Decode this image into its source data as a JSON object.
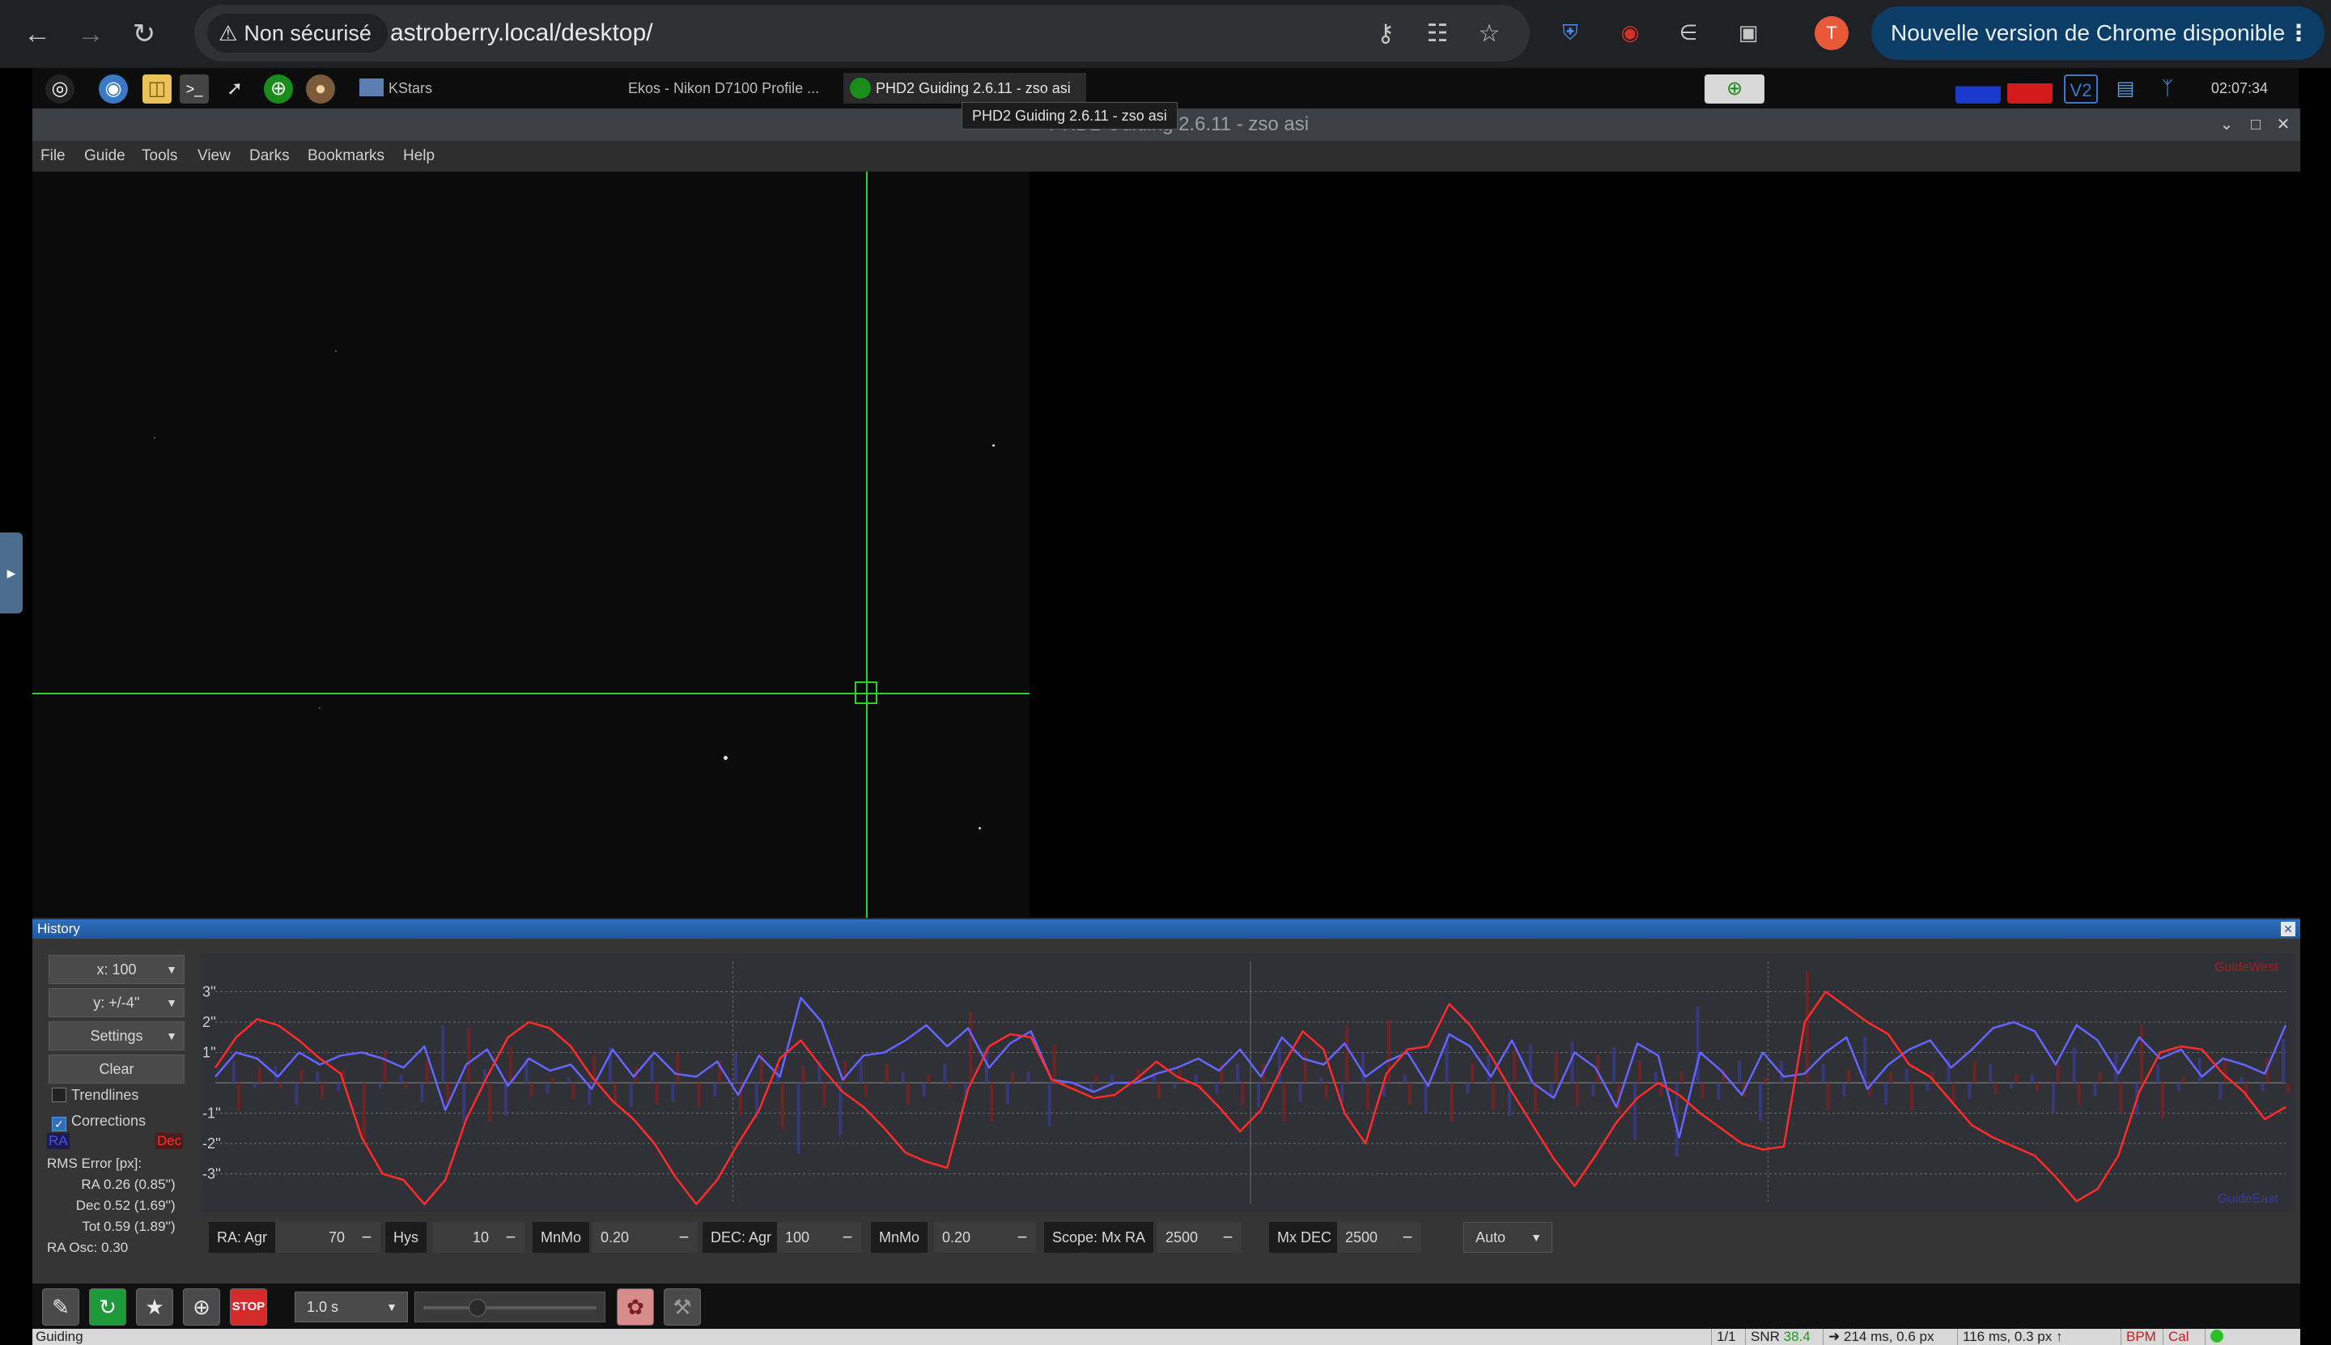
{
  "browser": {
    "security_label": "Non sécurisé",
    "url": "astroberry.local/desktop/",
    "profile_initial": "T",
    "update_label": "Nouvelle version de Chrome disponible",
    "accent": "#0b3d66"
  },
  "taskbar": {
    "tasks": [
      "KStars",
      "Ekos - Nikon D7100 Profile ...",
      "PHD2 Guiding 2.6.11 - zso asi"
    ],
    "clock": "02:07:34",
    "tooltip": "PHD2 Guiding 2.6.11 - zso asi"
  },
  "window": {
    "title": "PHD2 Guiding 2.6.11 - zso asi",
    "menu": [
      "File",
      "Guide",
      "Tools",
      "View",
      "Darks",
      "Bookmarks",
      "Help"
    ]
  },
  "history": {
    "title": "History",
    "x_scale": "x: 100",
    "y_scale": "y: +/-4''",
    "settings_label": "Settings",
    "clear_label": "Clear",
    "trendlines_label": "Trendlines",
    "trendlines_checked": false,
    "corrections_label": "Corrections",
    "corrections_checked": true,
    "ra_label": "RA",
    "dec_label": "Dec",
    "rms_title": "RMS Error [px]:",
    "rms_ra_label": "RA",
    "rms_ra": "0.26 (0.85'')",
    "rms_dec_label": "Dec",
    "rms_dec": "0.52 (1.69'')",
    "rms_tot_label": "Tot",
    "rms_tot": "0.59 (1.89'')",
    "ra_osc": "RA Osc: 0.30",
    "y_ticks": [
      "3''",
      "2''",
      "1''",
      "-1''",
      "-2''",
      "-3''"
    ],
    "legend_top": "GuideWest",
    "legend_bottom": "GuideEast",
    "ra_color": "#6464ff",
    "dec_color": "#ff2a2a",
    "controls": {
      "ra_agr_label": "RA: Agr",
      "ra_agr": "70",
      "hys_label": "Hys",
      "hys": "10",
      "mnmo_label": "MnMo",
      "mnmo": "0.20",
      "dec_agr_label": "DEC: Agr",
      "dec_agr": "100",
      "dec_mnmo_label": "MnMo",
      "dec_mnmo": "0.20",
      "scope_label": "Scope: Mx RA",
      "mx_ra": "2500",
      "mx_dec_label": "Mx DEC",
      "mx_dec": "2500",
      "dec_mode": "Auto"
    }
  },
  "toolbar": {
    "exposure": "1.0 s"
  },
  "status": {
    "state": "Guiding",
    "frame": "1/1",
    "snr_label": "SNR",
    "snr": "38.4",
    "ra_pulse": "214 ms, 0.6 px",
    "dec_pulse": "116 ms, 0.3 px",
    "bpm": "BPM",
    "cal": "Cal"
  },
  "chart_data": {
    "type": "line",
    "ylim": [
      -4,
      4
    ],
    "x": [
      0,
      1,
      2,
      3,
      4,
      5,
      6,
      7,
      8,
      9,
      10,
      11,
      12,
      13,
      14,
      15,
      16,
      17,
      18,
      19,
      20,
      21,
      22,
      23,
      24,
      25,
      26,
      27,
      28,
      29,
      30,
      31,
      32,
      33,
      34,
      35,
      36,
      37,
      38,
      39,
      40,
      41,
      42,
      43,
      44,
      45,
      46,
      47,
      48,
      49,
      50,
      51,
      52,
      53,
      54,
      55,
      56,
      57,
      58,
      59,
      60,
      61,
      62,
      63,
      64,
      65,
      66,
      67,
      68,
      69,
      70,
      71,
      72,
      73,
      74,
      75,
      76,
      77,
      78,
      79,
      80,
      81,
      82,
      83,
      84,
      85,
      86,
      87,
      88,
      89,
      90,
      91,
      92,
      93,
      94,
      95,
      96,
      97,
      98,
      99
    ],
    "series": [
      {
        "name": "RA",
        "values": [
          0.2,
          1.0,
          0.8,
          0.2,
          1.0,
          0.6,
          0.9,
          1.0,
          0.8,
          0.5,
          1.2,
          -0.9,
          0.6,
          1.1,
          -0.1,
          0.8,
          0.4,
          0.6,
          -0.2,
          1.1,
          0.2,
          1.0,
          0.3,
          0.2,
          0.7,
          -0.4,
          0.9,
          0.2,
          2.8,
          2.0,
          0.1,
          0.9,
          1.0,
          1.4,
          1.9,
          1.2,
          1.8,
          0.5,
          1.3,
          1.7,
          0.1,
          0.0,
          -0.3,
          0.0,
          0.0,
          0.3,
          0.5,
          0.8,
          0.4,
          1.1,
          0.2,
          1.5,
          0.8,
          0.6,
          1.3,
          0.2,
          0.7,
          1.0,
          -0.1,
          1.6,
          1.2,
          0.2,
          1.4,
          0.0,
          -0.5,
          1.0,
          0.5,
          -0.8,
          1.3,
          0.9,
          -1.8,
          1.0,
          0.4,
          -0.4,
          1.0,
          0.2,
          0.3,
          1.0,
          1.5,
          -0.2,
          0.6,
          1.1,
          1.4,
          0.5,
          1.1,
          1.8,
          2.0,
          1.7,
          0.6,
          1.9,
          1.4,
          0.3,
          1.5,
          0.8,
          1.1,
          0.2,
          0.8,
          0.6,
          0.3,
          1.9
        ]
      },
      {
        "name": "Dec",
        "values": [
          0.5,
          1.5,
          2.1,
          1.9,
          1.4,
          0.8,
          0.3,
          -1.8,
          -3.0,
          -3.2,
          -4.0,
          -3.2,
          -1.2,
          0.2,
          1.5,
          2.0,
          1.8,
          1.2,
          0.2,
          -0.6,
          -1.2,
          -2.0,
          -3.1,
          -4.0,
          -3.2,
          -2.0,
          -0.9,
          0.8,
          1.4,
          0.5,
          -0.3,
          -0.8,
          -1.5,
          -2.3,
          -2.6,
          -2.8,
          -0.2,
          1.2,
          1.6,
          1.5,
          0.1,
          -0.2,
          -0.5,
          -0.4,
          0.1,
          0.7,
          0.2,
          -0.1,
          -0.8,
          -1.6,
          -0.9,
          0.5,
          1.7,
          1.1,
          -1.0,
          -2.0,
          0.3,
          1.1,
          1.2,
          2.6,
          1.9,
          0.9,
          -0.3,
          -1.4,
          -2.5,
          -3.4,
          -2.4,
          -1.3,
          -0.5,
          0.0,
          -0.4,
          -1.0,
          -1.5,
          -2.0,
          -2.2,
          -2.1,
          2.0,
          3.0,
          2.5,
          2.0,
          1.6,
          0.6,
          0.2,
          -0.6,
          -1.4,
          -1.8,
          -2.1,
          -2.4,
          -3.1,
          -3.9,
          -3.5,
          -2.4,
          -0.3,
          1.0,
          1.2,
          1.1,
          0.3,
          -0.3,
          -1.2,
          -0.8
        ]
      }
    ]
  }
}
